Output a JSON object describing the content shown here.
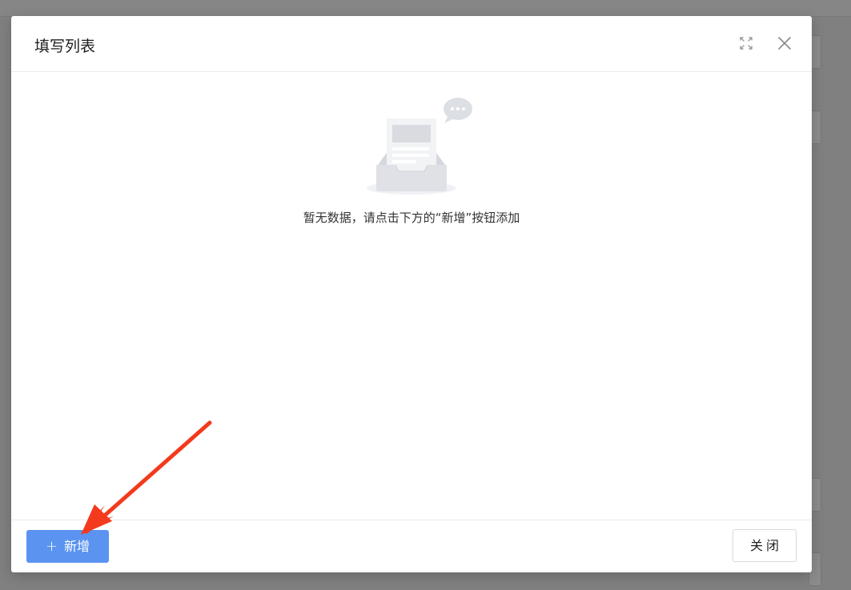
{
  "dialog": {
    "title": "填写列表",
    "expand_icon": "expand-icon",
    "close_icon": "close-icon"
  },
  "empty_state": {
    "illustration": "empty-inbox-illustration",
    "message": "暂无数据，请点击下方的“新增”按钮添加"
  },
  "footer": {
    "add_icon": "plus-icon",
    "add_label": "新增",
    "close_label": "关闭"
  },
  "colors": {
    "primary": "#5a94f0",
    "annotation_arrow": "#f33a1d"
  }
}
